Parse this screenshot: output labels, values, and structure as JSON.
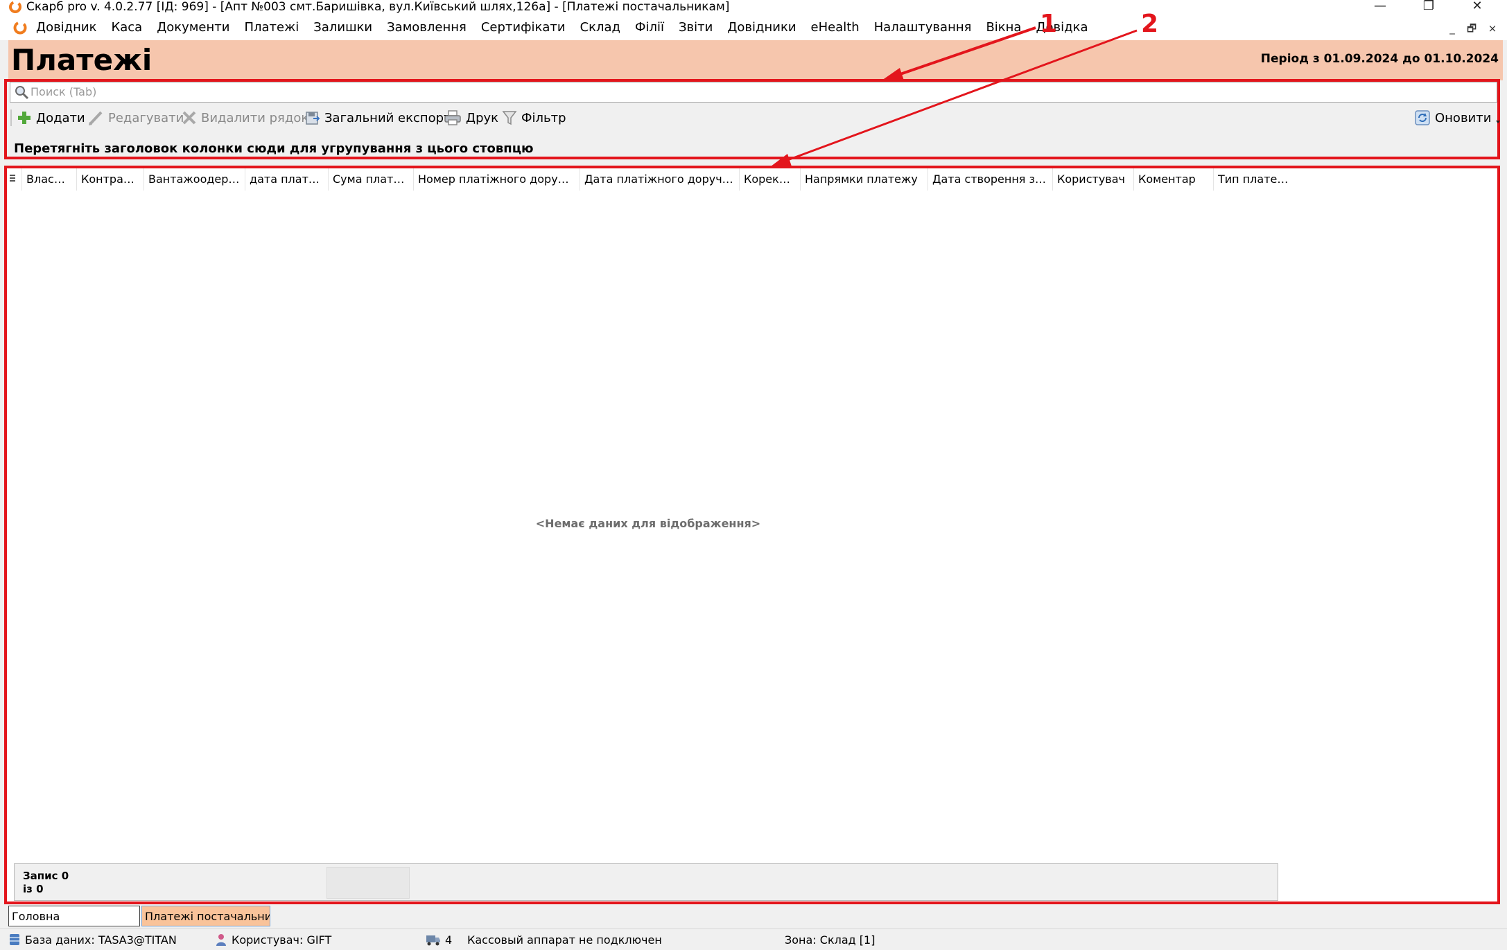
{
  "window": {
    "title": "Скарб pro v. 4.0.2.77 [ІД: 969] - [Апт №003 смт.Баришівка, вул.Київський шлях,126а] - [Платежі постачальникам]",
    "minimize_glyph": "—",
    "restore_glyph": "❐",
    "close_glyph": "✕"
  },
  "menu": {
    "items": [
      "Довідник",
      "Каса",
      "Документи",
      "Платежі",
      "Залишки",
      "Замовлення",
      "Сертифікати",
      "Склад",
      "Філії",
      "Звіти",
      "Довідники",
      "eHealth",
      "Налаштування",
      "Вікна",
      "Довідка"
    ],
    "mdi_minimize": "_",
    "mdi_restore": "🗗",
    "mdi_close": "×"
  },
  "header": {
    "title": "Платежі",
    "period": "Період з 01.09.2024 до 01.10.2024"
  },
  "search": {
    "placeholder": "Поиск (Tab)"
  },
  "toolbar": {
    "add": "Додати",
    "edit": "Редагувати",
    "delete": "Видалити рядок",
    "export": "Загальний експорт",
    "print": "Друк",
    "filter": "Фільтр",
    "refresh": "Оновити"
  },
  "group_hint": "Перетягніть заголовок колонки сюди для угрупування з цього стовпцю",
  "grid": {
    "columns": [
      "Власник",
      "Контрагент",
      "Вантажоодерж...",
      "дата платежу",
      "Сума платежу",
      "Номер платіжного доручення",
      "Дата платіжного доручення",
      "Корекція",
      "Напрямки платежу",
      "Дата створення за...",
      "Користувач",
      "Коментар",
      "Тип платежу"
    ],
    "empty_message": "<Немає даних для відображення>",
    "record_count": "Запис 0\nіз 0"
  },
  "tabs": [
    "Головна",
    "Платежі постачальни ..."
  ],
  "status": {
    "database": "База даних: TASA3@TITAN",
    "user": "Користувач: GIFT",
    "count": "4",
    "cash_register": "Кассовый аппарат не подключен",
    "zone": "Зона: Склад [1]"
  },
  "annotations": {
    "label1": "1",
    "label2": "2",
    "color": "#e3151c"
  },
  "colors": {
    "header_bg": "#f6c6ad",
    "active_tab_bg": "#f9c39a",
    "annotation": "#e3151c",
    "logo_orange": "#f07c1e"
  }
}
